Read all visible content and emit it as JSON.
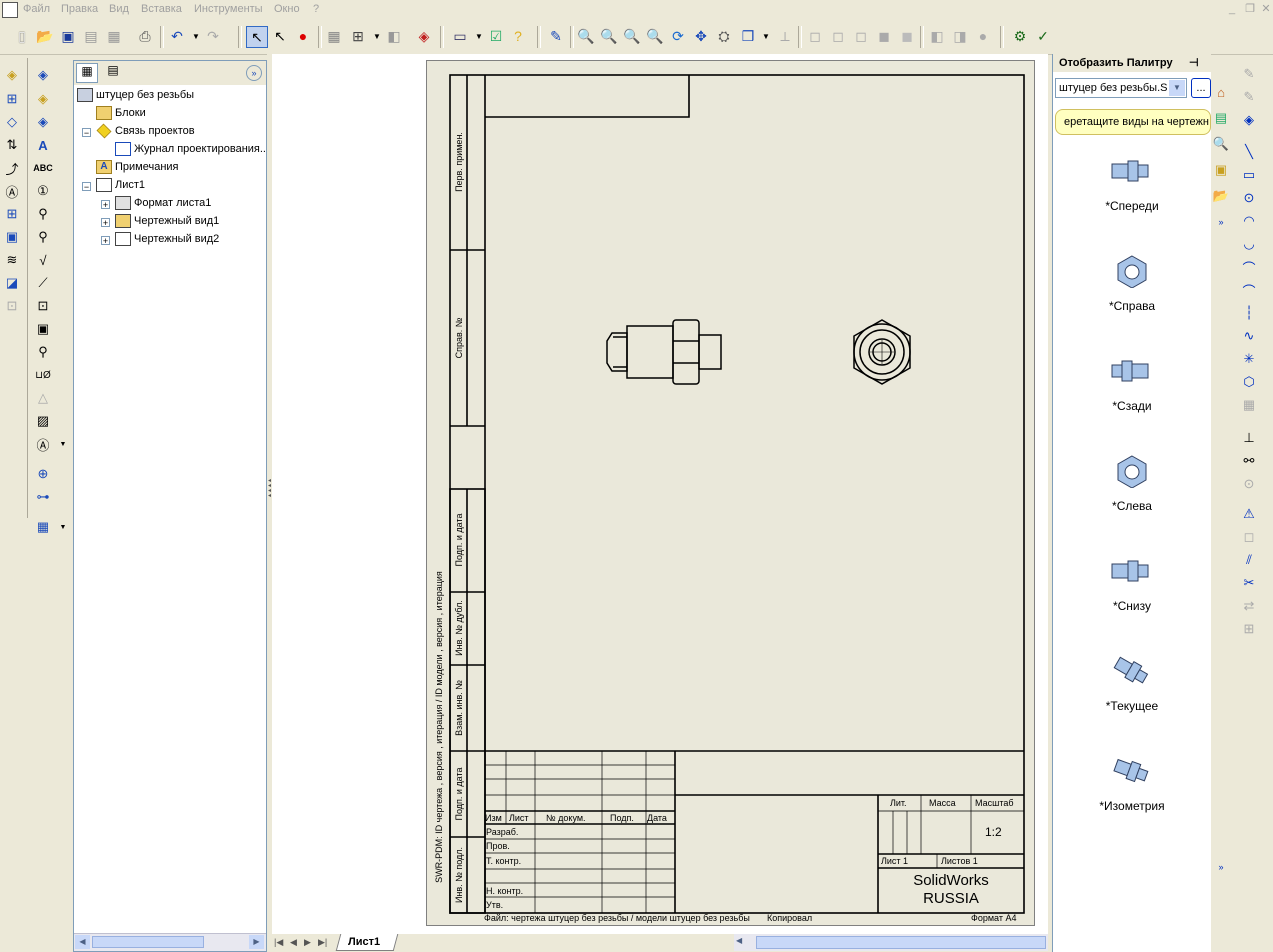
{
  "menu": {
    "items": [
      "Файл",
      "Правка",
      "Вид",
      "Вставка",
      "Инструменты",
      "Окно",
      "?"
    ]
  },
  "tree": {
    "root": "штуцер без резьбы",
    "items": [
      {
        "label": "Блоки",
        "icon": "blocks-folder-icon"
      },
      {
        "label": "Связь проектов",
        "icon": "project-link-icon"
      },
      {
        "label": "Журнал проектирования...",
        "icon": "design-journal-icon"
      },
      {
        "label": "Примечания",
        "icon": "annotations-icon"
      },
      {
        "label": "Лист1",
        "icon": "sheet-icon"
      },
      {
        "label": "Формат листа1",
        "icon": "sheet-format-icon"
      },
      {
        "label": "Чертежный вид1",
        "icon": "drawing-view-icon"
      },
      {
        "label": "Чертежный вид2",
        "icon": "drawing-view-icon"
      }
    ]
  },
  "palette": {
    "title": "Отобразить Палитру",
    "file_select": "штуцер без резьбы.S",
    "browse_label": "...",
    "hint": "еретащите виды на чертежн",
    "views": [
      {
        "label": "*Спереди",
        "icon": "front-view-icon"
      },
      {
        "label": "*Справа",
        "icon": "right-view-icon"
      },
      {
        "label": "*Сзади",
        "icon": "back-view-icon"
      },
      {
        "label": "*Слева",
        "icon": "left-view-icon"
      },
      {
        "label": "*Снизу",
        "icon": "bottom-view-icon"
      },
      {
        "label": "*Текущее",
        "icon": "current-view-icon"
      },
      {
        "label": "*Изометрия",
        "icon": "isometric-view-icon"
      }
    ]
  },
  "drawing": {
    "left_stamps": [
      "Перв. примен.",
      "Справ. №",
      "Подп. и дата",
      "Инв. № дубл.",
      "Взам. инв. №",
      "Подп. и дата",
      "Инв. № подл."
    ],
    "vertical_note": "SWR-PDM: ID чертежа , версия , итерация / ID модели , версия , итерация",
    "title_block": {
      "col_headers": [
        "Изм",
        "Лист",
        "№ докум.",
        "Подп.",
        "Дата"
      ],
      "rows": [
        "Разраб.",
        "Пров.",
        "Т. контр.",
        "Н. контр.",
        "Утв."
      ],
      "lit": "Лит.",
      "mass": "Масса",
      "scale_label": "Масштаб",
      "scale_value": "1:2",
      "sheet": "Лист 1",
      "sheets": "Листов 1",
      "company_line1": "SolidWorks",
      "company_line2": "RUSSIA"
    },
    "file_note": "Файл: чертежа штуцер без резьбы / модели штуцер без резьбы",
    "copied": "Копировал",
    "format": "Формат А4"
  },
  "sheet_tab": "Лист1"
}
